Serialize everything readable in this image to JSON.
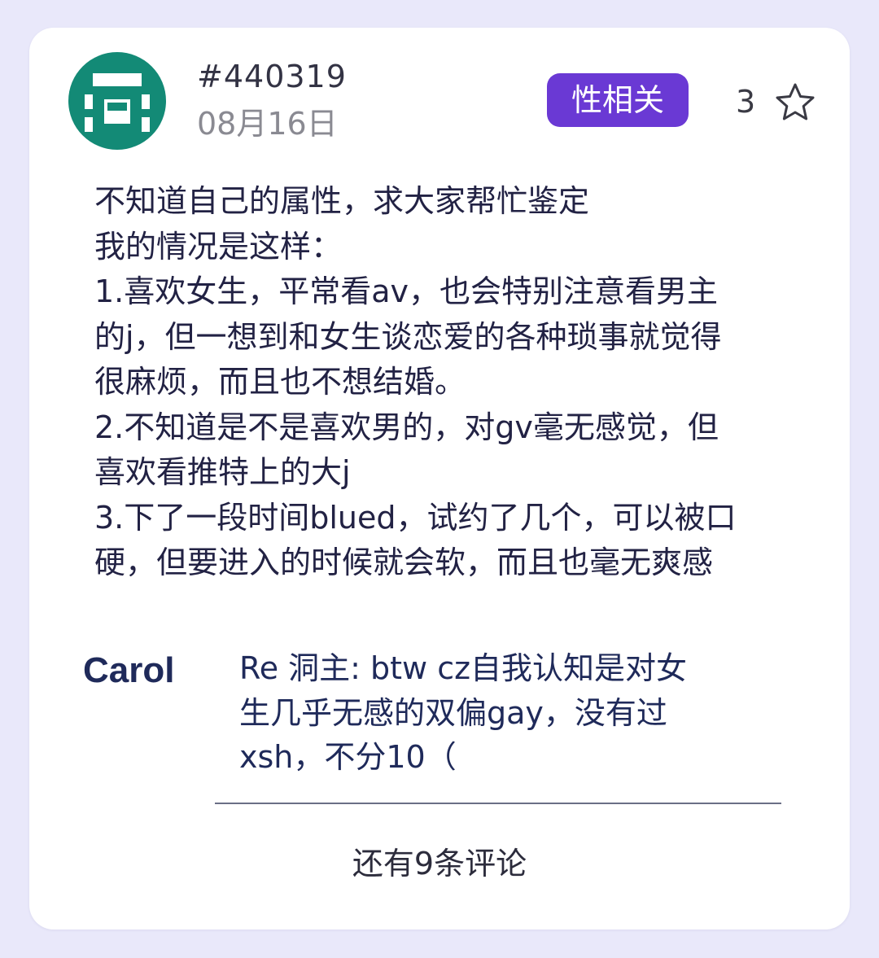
{
  "post": {
    "id": "#440319",
    "date": "08月16日",
    "tag": "性相关",
    "star_count": "3",
    "body_lines": [
      "不知道自己的属性，求大家帮忙鉴定",
      "我的情况是这样：",
      "1.喜欢女生，平常看av，也会特别注意看男主",
      "的j，但一想到和女生谈恋爱的各种琐事就觉得",
      "很麻烦，而且也不想结婚。",
      "2.不知道是不是喜欢男的，对gv毫无感觉，但",
      "喜欢看推特上的大j",
      "3.下了一段时间blued，试约了几个，可以被口",
      "硬，但要进入的时候就会软，而且也毫无爽感"
    ]
  },
  "comment": {
    "author": "Carol",
    "text_lines": [
      "Re 洞主: btw cz自我认知是对女",
      "生几乎无感的双偏gay，没有过",
      "xsh，不分10（"
    ]
  },
  "more_comments": "还有9条评论",
  "colors": {
    "background": "#e9e8fa",
    "card": "#ffffff",
    "tag": "#6a39d4",
    "avatar": "#138a76",
    "text": "#222244"
  },
  "icons": {
    "avatar": "identicon-avatar",
    "star": "star-outline-icon"
  }
}
